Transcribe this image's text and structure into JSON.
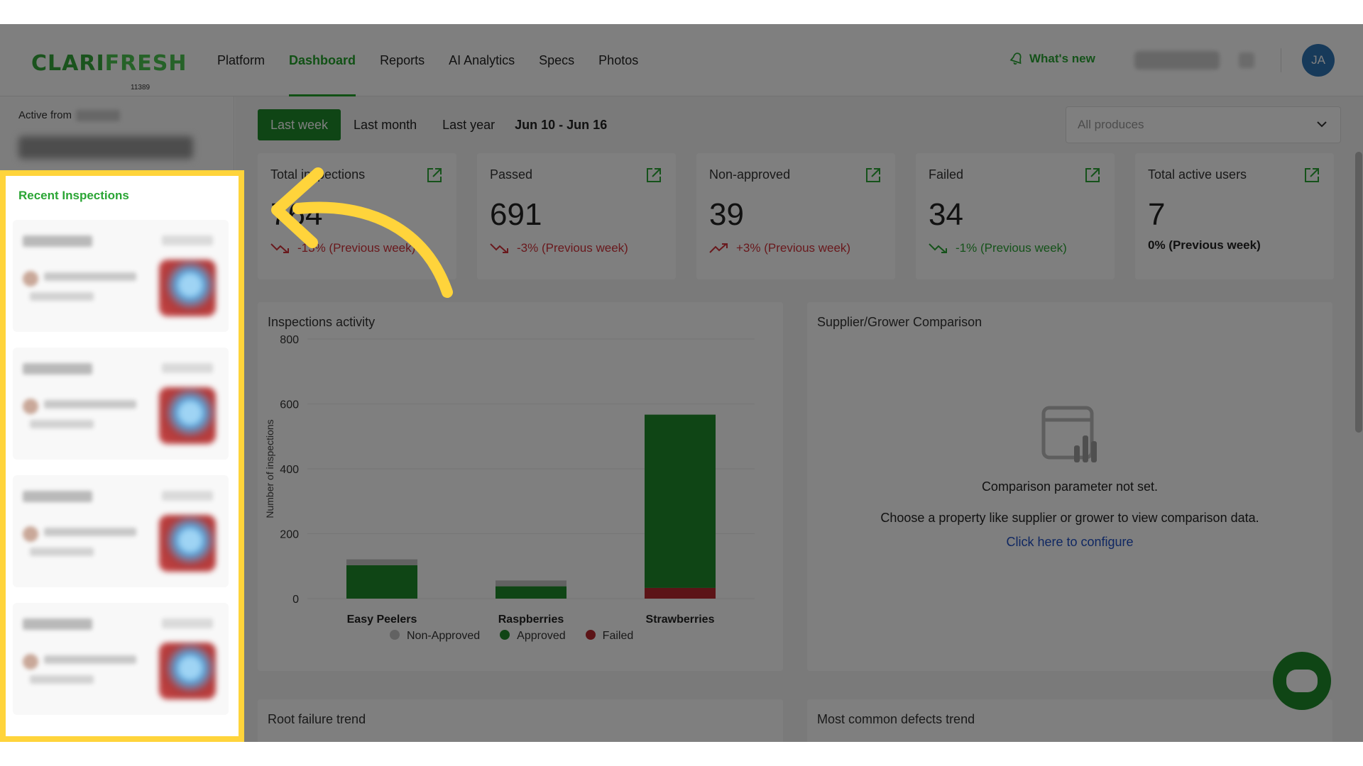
{
  "app": {
    "logo": "CLARIFRESH",
    "logo_part1": "CLARI",
    "logo_part2": "FRESH",
    "logo_sub": "11389"
  },
  "nav": {
    "items": [
      {
        "label": "Platform",
        "active": false
      },
      {
        "label": "Dashboard",
        "active": true
      },
      {
        "label": "Reports",
        "active": false
      },
      {
        "label": "AI Analytics",
        "active": false
      },
      {
        "label": "Specs",
        "active": false
      },
      {
        "label": "Photos",
        "active": false
      }
    ],
    "whats_new": "What's new",
    "avatar_initials": "JA"
  },
  "sidebar": {
    "active_from_label": "Active from",
    "recent_title": "Recent Inspections"
  },
  "filters": {
    "last_week": "Last week",
    "last_month": "Last month",
    "last_year": "Last year",
    "date_range": "Jun 10 - Jun 16",
    "produce_placeholder": "All produces"
  },
  "stats": [
    {
      "label": "Total inspections",
      "value": "764",
      "change": "-13% (Previous week)",
      "trend": "down",
      "color": "red"
    },
    {
      "label": "Passed",
      "value": "691",
      "change": "-3% (Previous week)",
      "trend": "down",
      "color": "red"
    },
    {
      "label": "Non-approved",
      "value": "39",
      "change": "+3% (Previous week)",
      "trend": "up",
      "color": "red"
    },
    {
      "label": "Failed",
      "value": "34",
      "change": "-1% (Previous week)",
      "trend": "down",
      "color": "green"
    },
    {
      "label": "Total active users",
      "value": "7",
      "change": "0% (Previous week)",
      "trend": "none",
      "color": "neutral"
    }
  ],
  "activity": {
    "title": "Inspections activity",
    "ylabel": "Number of inspections",
    "legend": [
      "Non-Approved",
      "Approved",
      "Failed"
    ]
  },
  "comparison": {
    "title": "Supplier/Grower Comparison",
    "message1": "Comparison parameter not set.",
    "message2": "Choose a property like supplier or grower to view comparison data.",
    "link": "Click here to configure"
  },
  "bottom": {
    "root_failure": "Root failure trend",
    "common_defects": "Most common defects trend"
  },
  "colors": {
    "brand_green": "#1e8a2a",
    "accent_green": "#2aa534",
    "failed_red": "#b8282e",
    "non_approved_gray": "#c4c4c4",
    "highlight_yellow": "#ffd43b",
    "avatar_blue": "#2e74b5"
  },
  "chart_data": {
    "type": "bar",
    "stacked": true,
    "categories": [
      "Easy Peelers",
      "Raspberries",
      "Strawberries"
    ],
    "series": [
      {
        "name": "Failed",
        "values": [
          0,
          0,
          33
        ]
      },
      {
        "name": "Approved",
        "values": [
          103,
          38,
          534
        ]
      },
      {
        "name": "Non-Approved",
        "values": [
          18,
          18,
          0
        ]
      }
    ],
    "ylabel": "Number of inspections",
    "yticks": [
      0,
      200,
      400,
      600,
      800
    ],
    "ylim": [
      0,
      800
    ],
    "grid": true,
    "legend": "bottom"
  }
}
